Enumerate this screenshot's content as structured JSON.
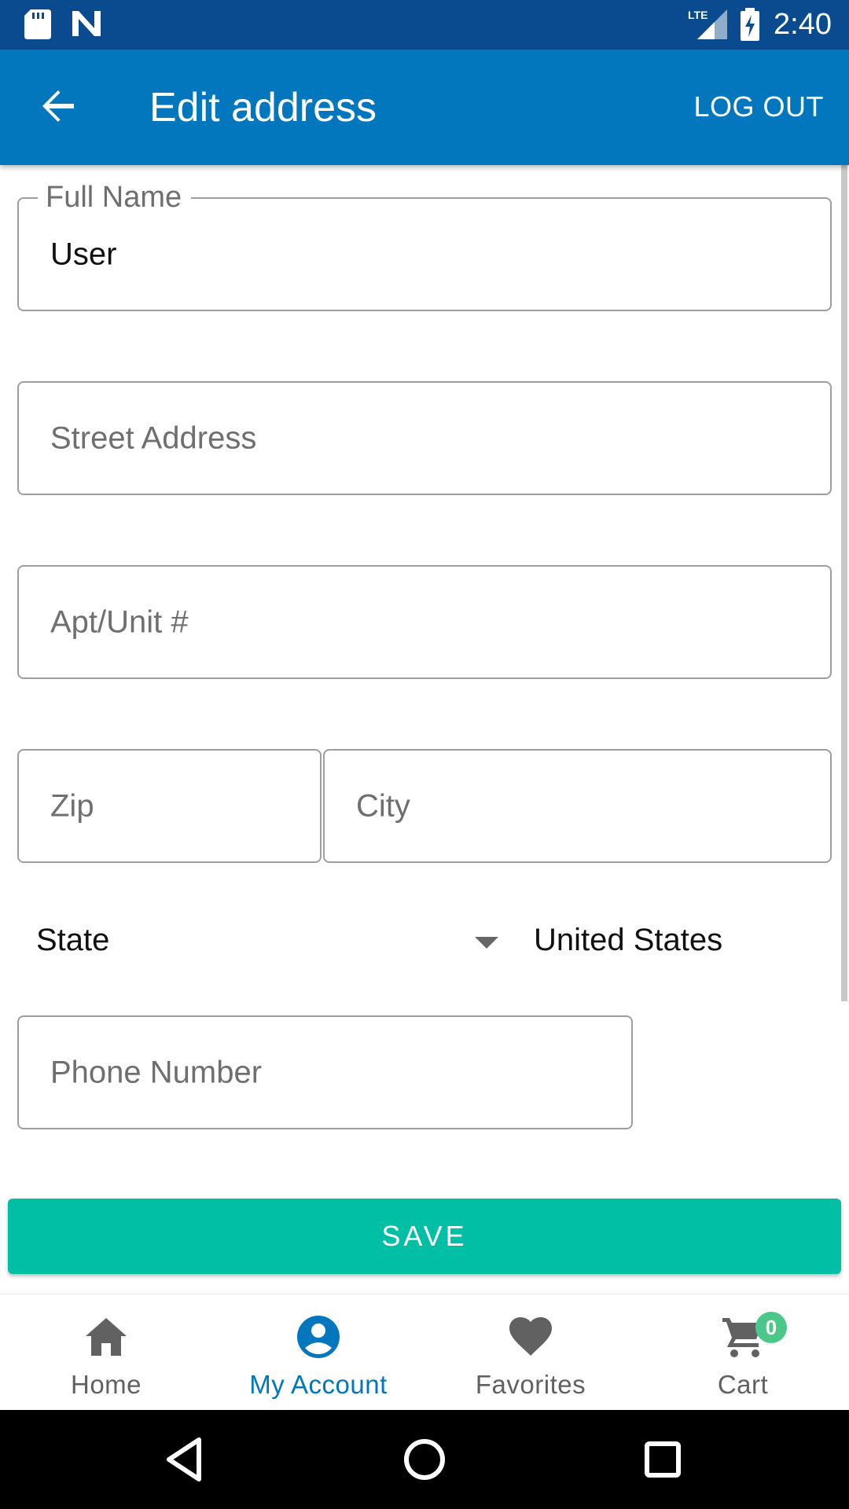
{
  "status_bar": {
    "time": "2:40",
    "network": "LTE",
    "icons": [
      "sd-card-icon",
      "n-notification-icon",
      "lte-signal-icon",
      "battery-charging-icon"
    ]
  },
  "app_bar": {
    "title": "Edit address",
    "back_icon": "arrow-back-icon",
    "logout_label": "LOG OUT"
  },
  "form": {
    "full_name": {
      "label": "Full Name",
      "value": "User"
    },
    "street_address": {
      "placeholder": "Street Address",
      "value": ""
    },
    "apt_unit": {
      "placeholder": "Apt/Unit #",
      "value": ""
    },
    "zip": {
      "placeholder": "Zip",
      "value": ""
    },
    "city": {
      "placeholder": "City",
      "value": ""
    },
    "state": {
      "selected": "State"
    },
    "country": "United States",
    "phone": {
      "placeholder": "Phone Number",
      "value": ""
    },
    "save_label": "SAVE"
  },
  "bottom_nav": {
    "items": [
      {
        "label": "Home",
        "icon": "home-icon",
        "active": false
      },
      {
        "label": "My Account",
        "icon": "account-circle-icon",
        "active": true
      },
      {
        "label": "Favorites",
        "icon": "heart-icon",
        "active": false
      },
      {
        "label": "Cart",
        "icon": "cart-icon",
        "active": false
      }
    ],
    "cart_count": "0"
  },
  "colors": {
    "status_bar": "#0a4a8f",
    "app_bar": "#0277bd",
    "accent": "#00bfa5",
    "active_nav": "#0277bd",
    "badge": "#4cc78a"
  }
}
